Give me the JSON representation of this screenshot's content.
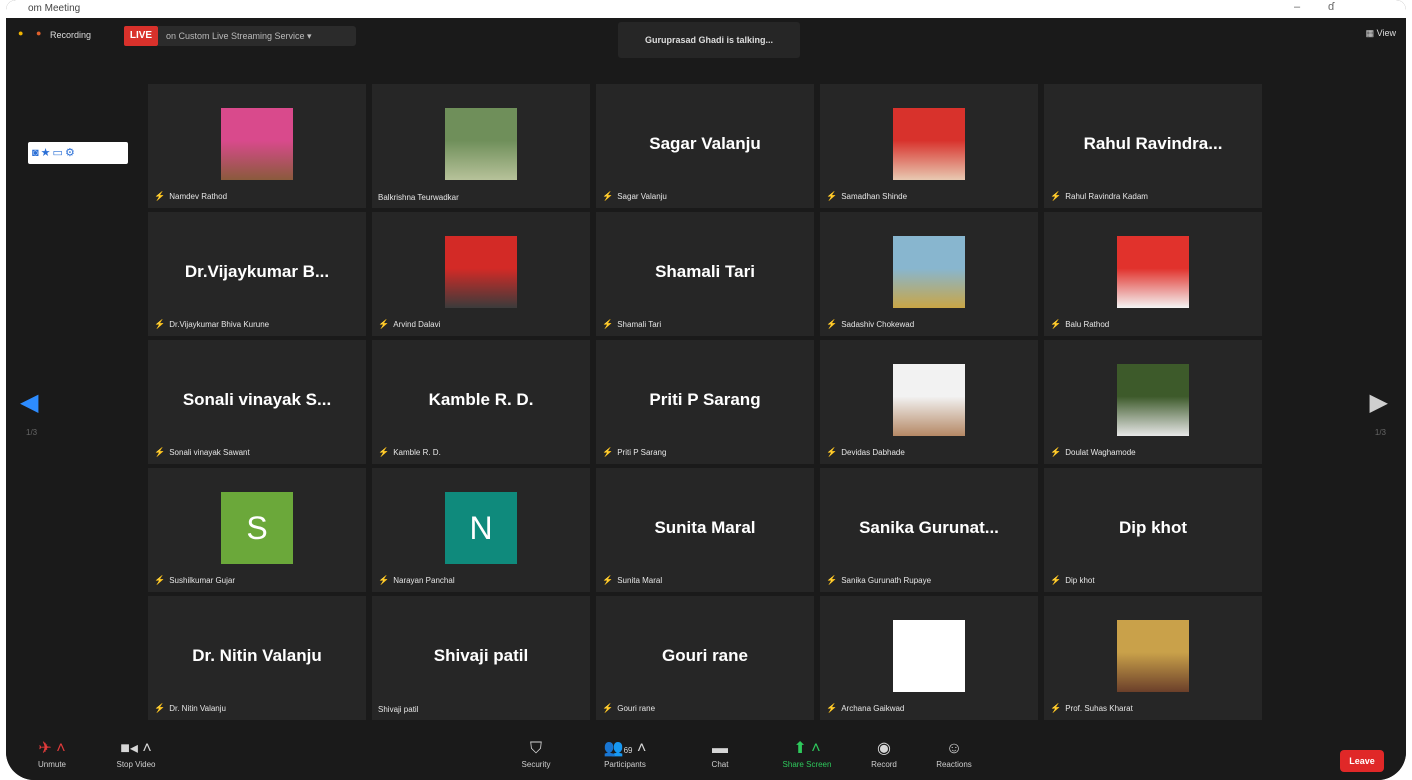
{
  "app": {
    "title": "om Meeting",
    "minimize": "–",
    "restore": "ɗ"
  },
  "topbar": {
    "recording_label": "Recording",
    "live_label": "LIVE",
    "service_label": "on Custom Live Streaming Service ▾",
    "talking": "Guruprasad Ghadi is talking...",
    "view_label": "View"
  },
  "nav": {
    "page_left": "1/3",
    "page_right": "1/3"
  },
  "tiles": [
    {
      "display": "photo",
      "big": "",
      "label": "Namdev Rathod",
      "muted": true,
      "colors": [
        "#d94a8c",
        "#8a5a3c"
      ]
    },
    {
      "display": "photo",
      "big": "",
      "label": "Balkrishna Teurwadkar",
      "muted": false,
      "colors": [
        "#6f8f5a",
        "#b7c29a"
      ]
    },
    {
      "display": "name",
      "big": "Sagar Valanju",
      "label": "Sagar Valanju",
      "muted": true
    },
    {
      "display": "photo",
      "big": "",
      "label": "Samadhan Shinde",
      "muted": true,
      "colors": [
        "#d8322c",
        "#e8c9b2"
      ]
    },
    {
      "display": "name",
      "big": "Rahul Ravindra...",
      "label": "Rahul Ravindra Kadam",
      "muted": true
    },
    {
      "display": "name",
      "big": "Dr.Vijaykumar B...",
      "label": "Dr.Vijaykumar Bhiva Kurune",
      "muted": true
    },
    {
      "display": "photo",
      "big": "",
      "label": "Arvind Dalavi",
      "muted": true,
      "colors": [
        "#d32a26",
        "#3b3b3b"
      ]
    },
    {
      "display": "name",
      "big": "Shamali Tari",
      "label": "Shamali Tari",
      "muted": true
    },
    {
      "display": "photo",
      "big": "",
      "label": "Sadashiv Chokewad",
      "muted": true,
      "colors": [
        "#88b6cf",
        "#c9a646"
      ]
    },
    {
      "display": "photo",
      "big": "",
      "label": "Balu Rathod",
      "muted": true,
      "colors": [
        "#e1322c",
        "#f4f4f4"
      ]
    },
    {
      "display": "name",
      "big": "Sonali vinayak S...",
      "label": "Sonali vinayak Sawant",
      "muted": true
    },
    {
      "display": "name",
      "big": "Kamble R. D.",
      "label": "Kamble R. D.",
      "muted": true
    },
    {
      "display": "name",
      "big": "Priti P Sarang",
      "label": "Priti P Sarang",
      "muted": true
    },
    {
      "display": "photo",
      "big": "",
      "label": "Devidas Dabhade",
      "muted": true,
      "colors": [
        "#f2f2f2",
        "#b58865"
      ]
    },
    {
      "display": "photo",
      "big": "",
      "label": "Doulat Waghamode",
      "muted": true,
      "colors": [
        "#3d5a2a",
        "#e7e7e7"
      ]
    },
    {
      "display": "initial",
      "big": "S",
      "label": "Sushilkumar Gujar",
      "muted": true,
      "colors": [
        "#6ba83a"
      ]
    },
    {
      "display": "initial",
      "big": "N",
      "label": "Narayan Panchal",
      "muted": true,
      "colors": [
        "#0f8a7c"
      ]
    },
    {
      "display": "name",
      "big": "Sunita Maral",
      "label": "Sunita Maral",
      "muted": true
    },
    {
      "display": "name",
      "big": "Sanika Gurunat...",
      "label": "Sanika Gurunath Rupaye",
      "muted": true
    },
    {
      "display": "name",
      "big": "Dip khot",
      "label": "Dip khot",
      "muted": true
    },
    {
      "display": "name",
      "big": "Dr. Nitin Valanju",
      "label": "Dr. Nitin Valanju",
      "muted": true
    },
    {
      "display": "name",
      "big": "Shivaji patil",
      "label": "Shivaji patil",
      "muted": false
    },
    {
      "display": "name",
      "big": "Gouri rane",
      "label": "Gouri rane",
      "muted": true
    },
    {
      "display": "photo",
      "big": "",
      "label": "Archana Gaikwad",
      "muted": true,
      "colors": [
        "#ffffff",
        "#ffffff"
      ]
    },
    {
      "display": "photo",
      "big": "",
      "label": "Prof. Suhas Kharat",
      "muted": true,
      "colors": [
        "#c9a14a",
        "#6b3f2a"
      ]
    }
  ],
  "toolbar": {
    "mute": "Unmute",
    "video": "Stop Video",
    "security": "Security",
    "participants": "Participants",
    "participants_count": "69",
    "chat": "Chat",
    "share": "Share Screen",
    "record": "Record",
    "reactions": "Reactions",
    "leave": "Leave"
  },
  "colors": {
    "accent": "#2d8cff",
    "live": "#d9312b",
    "share": "#2ec95c",
    "leave": "#e02828",
    "tile": "#262626"
  }
}
